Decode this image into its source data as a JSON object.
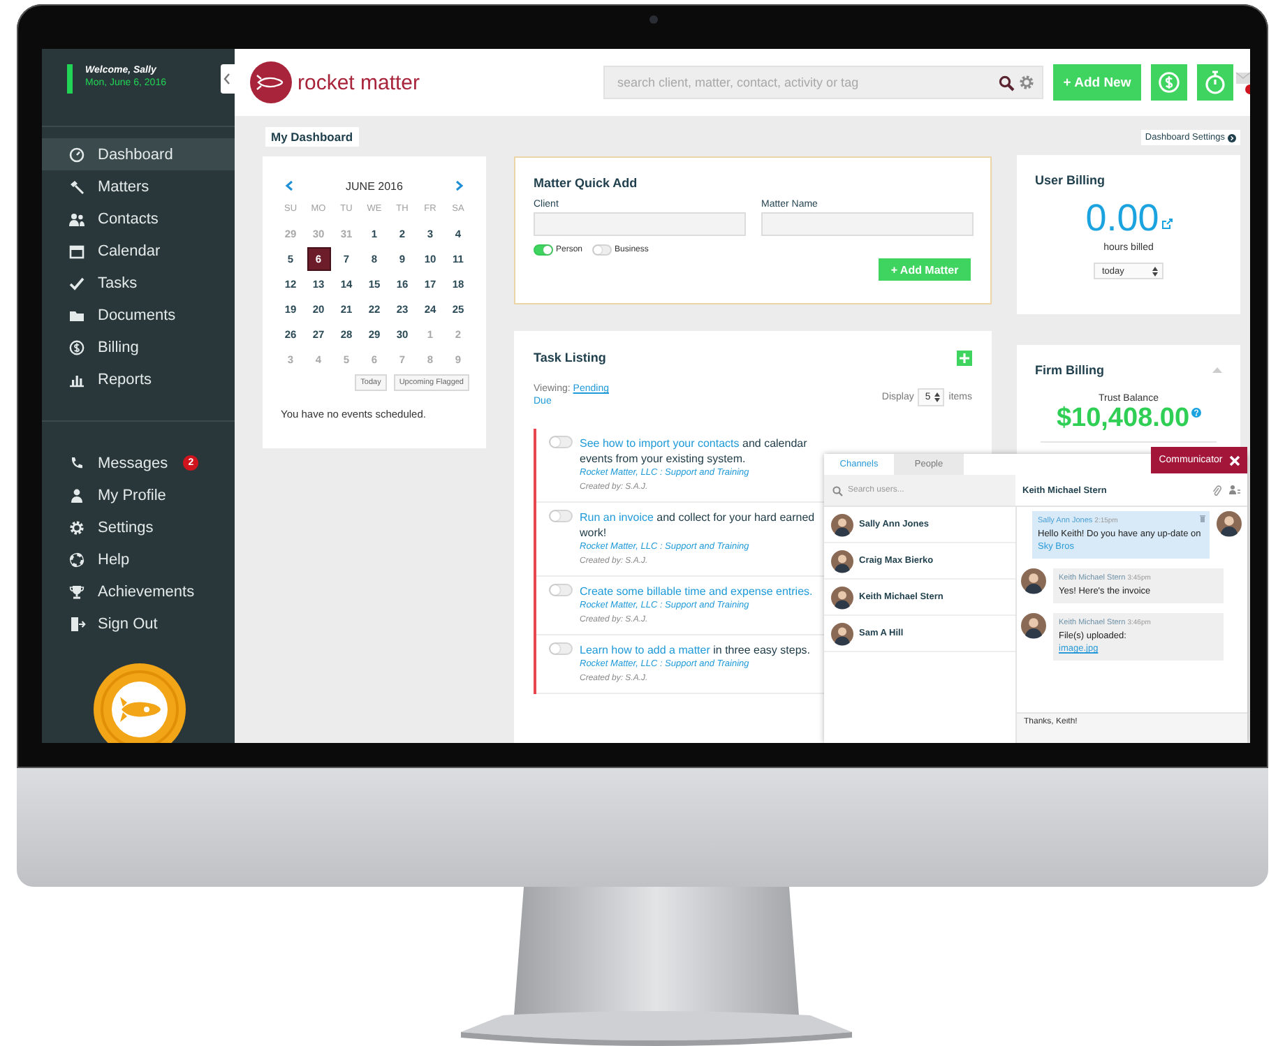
{
  "sidebar": {
    "welcome": "Welcome, Sally",
    "date": "Mon, June 6, 2016",
    "nav": [
      {
        "label": "Dashboard",
        "selected": true
      },
      {
        "label": "Matters",
        "selected": false
      },
      {
        "label": "Contacts",
        "selected": false
      },
      {
        "label": "Calendar",
        "selected": false
      },
      {
        "label": "Tasks",
        "selected": false
      },
      {
        "label": "Documents",
        "selected": false
      },
      {
        "label": "Billing",
        "selected": false
      },
      {
        "label": "Reports",
        "selected": false
      }
    ],
    "secondary": [
      {
        "label": "Messages",
        "badge": "2"
      },
      {
        "label": "My Profile"
      },
      {
        "label": "Settings"
      },
      {
        "label": "Help"
      },
      {
        "label": "Achievements"
      },
      {
        "label": "Sign Out"
      }
    ]
  },
  "topbar": {
    "logo_text": "rocket matter",
    "search": {
      "placeholder": "search client, matter, contact, activity or tag"
    },
    "add_new_button": "+ Add New"
  },
  "dashboard": {
    "title": "My Dashboard",
    "settings_link": "Dashboard Settings"
  },
  "calendar": {
    "month": "JUNE 2016",
    "weekdays": [
      "SU",
      "MO",
      "TU",
      "WE",
      "TH",
      "FR",
      "SA"
    ],
    "weeks": [
      [
        {
          "day": "29",
          "muted": true,
          "selected": false
        },
        {
          "day": "30",
          "muted": true,
          "selected": false
        },
        {
          "day": "31",
          "muted": true,
          "selected": false
        },
        {
          "day": "1",
          "muted": false,
          "selected": false
        },
        {
          "day": "2",
          "muted": false,
          "selected": false
        },
        {
          "day": "3",
          "muted": false,
          "selected": false
        },
        {
          "day": "4",
          "muted": false,
          "selected": false
        }
      ],
      [
        {
          "day": "5",
          "muted": false,
          "selected": false
        },
        {
          "day": "6",
          "muted": false,
          "selected": true
        },
        {
          "day": "7",
          "muted": false,
          "selected": false
        },
        {
          "day": "8",
          "muted": false,
          "selected": false
        },
        {
          "day": "9",
          "muted": false,
          "selected": false
        },
        {
          "day": "10",
          "muted": false,
          "selected": false
        },
        {
          "day": "11",
          "muted": false,
          "selected": false
        }
      ],
      [
        {
          "day": "12",
          "muted": false,
          "selected": false
        },
        {
          "day": "13",
          "muted": false,
          "selected": false
        },
        {
          "day": "14",
          "muted": false,
          "selected": false
        },
        {
          "day": "15",
          "muted": false,
          "selected": false
        },
        {
          "day": "16",
          "muted": false,
          "selected": false
        },
        {
          "day": "17",
          "muted": false,
          "selected": false
        },
        {
          "day": "18",
          "muted": false,
          "selected": false
        }
      ],
      [
        {
          "day": "19",
          "muted": false,
          "selected": false
        },
        {
          "day": "20",
          "muted": false,
          "selected": false
        },
        {
          "day": "21",
          "muted": false,
          "selected": false
        },
        {
          "day": "22",
          "muted": false,
          "selected": false
        },
        {
          "day": "23",
          "muted": false,
          "selected": false
        },
        {
          "day": "24",
          "muted": false,
          "selected": false
        },
        {
          "day": "25",
          "muted": false,
          "selected": false
        }
      ],
      [
        {
          "day": "26",
          "muted": false,
          "selected": false
        },
        {
          "day": "27",
          "muted": false,
          "selected": false
        },
        {
          "day": "28",
          "muted": false,
          "selected": false
        },
        {
          "day": "29",
          "muted": false,
          "selected": false
        },
        {
          "day": "30",
          "muted": false,
          "selected": false
        },
        {
          "day": "1",
          "muted": true,
          "selected": false
        },
        {
          "day": "2",
          "muted": true,
          "selected": false
        }
      ],
      [
        {
          "day": "3",
          "muted": true,
          "selected": false
        },
        {
          "day": "4",
          "muted": true,
          "selected": false
        },
        {
          "day": "5",
          "muted": true,
          "selected": false
        },
        {
          "day": "6",
          "muted": true,
          "selected": false
        },
        {
          "day": "7",
          "muted": true,
          "selected": false
        },
        {
          "day": "8",
          "muted": true,
          "selected": false
        },
        {
          "day": "9",
          "muted": true,
          "selected": false
        }
      ]
    ],
    "buttons": [
      "Today",
      "Upcoming Flagged"
    ],
    "empty_message": "You have no events scheduled."
  },
  "matter_quick_add": {
    "title": "Matter Quick Add",
    "fields": [
      {
        "label": "Client"
      },
      {
        "label": "Matter Name"
      }
    ],
    "types": [
      {
        "label": "Person",
        "on": true
      },
      {
        "label": "Business",
        "on": false
      }
    ],
    "button": "+ Add Matter"
  },
  "task_listing": {
    "title": "Task Listing",
    "viewing_label": "Viewing:",
    "filter": "Pending",
    "filter_2": "Due",
    "display_label": "Display",
    "display_count": "5",
    "display_unit": "items",
    "tasks": [
      {
        "link": "See how to import your contacts",
        "text": " and calendar events from your existing system.",
        "matter": "Rocket Matter, LLC : Support and Training",
        "created": "Created by: S.A.J.",
        "done": false
      },
      {
        "link": "Run an invoice",
        "text": " and collect for your hard earned work!",
        "matter": "Rocket Matter, LLC : Support and Training",
        "created": "Created by: S.A.J.",
        "done": false
      },
      {
        "link": "Create some billable time and expense entries.",
        "matter": "Rocket Matter, LLC : Support and Training",
        "created": "Created by: S.A.J.",
        "done": false
      },
      {
        "link": "Learn how to add a matter",
        "text": " in three easy steps.",
        "matter": "Rocket Matter, LLC : Support and Training",
        "created": "Created by: S.A.J.",
        "done": false
      }
    ]
  },
  "user_billing": {
    "title": "User Billing",
    "value": "0.00",
    "caption": "hours billed",
    "period": "today"
  },
  "firm_billing": {
    "title": "Firm Billing",
    "caption": "Trust Balance",
    "amount": "$10,408.00"
  },
  "communicator": {
    "tab": "Communicator",
    "tabs": [
      {
        "label": "Channels",
        "selected": true
      },
      {
        "label": "People",
        "selected": false
      }
    ],
    "search_placeholder": "Search users...",
    "users": [
      "Sally Ann Jones",
      "Craig Max Bierko",
      "Keith Michael Stern",
      "Sam A Hill"
    ],
    "chat_title": "Keith Michael Stern",
    "messages": [
      {
        "kind": "sent",
        "sender": "Sally Ann Jones",
        "time": "2:15pm",
        "text": "Hello Keith! Do you have any up-date on ",
        "link": "Sky Bros"
      },
      {
        "kind": "received",
        "sender": "Keith Michael Stern",
        "time": "3:45pm",
        "text": "Yes! Here's the invoice"
      },
      {
        "kind": "received",
        "sender": "Keith Michael Stern",
        "time": "3:46pm",
        "text": "File(s) uploaded:",
        "attachment": "image.jpg"
      }
    ],
    "reply": "Thanks, Keith!"
  }
}
